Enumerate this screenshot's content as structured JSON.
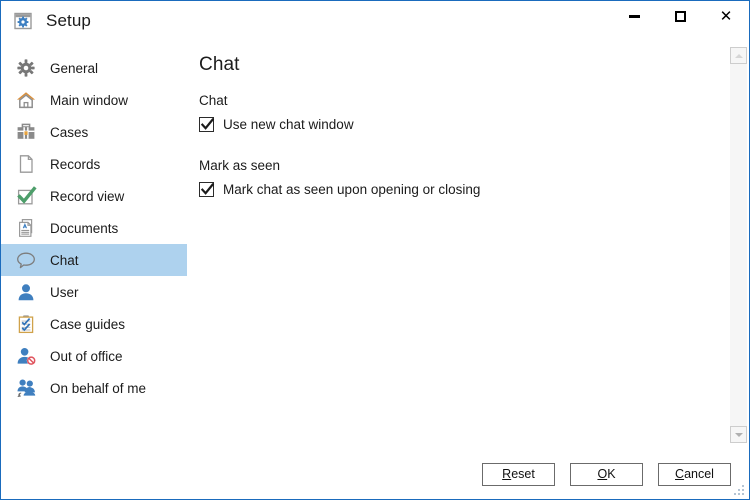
{
  "window": {
    "title": "Setup",
    "app_icon": "setup-gear-window-icon",
    "border_color": "#1a6bbd",
    "controls": {
      "minimize": "–",
      "maximize": "□",
      "close": "✕"
    }
  },
  "sidebar": {
    "selected": "Chat",
    "selected_color": "#aed2ee",
    "items": [
      {
        "label": "General",
        "icon": "gear-icon"
      },
      {
        "label": "Main window",
        "icon": "home-icon"
      },
      {
        "label": "Cases",
        "icon": "briefcase-icon"
      },
      {
        "label": "Records",
        "icon": "page-icon"
      },
      {
        "label": "Record view",
        "icon": "checkmark-box-icon"
      },
      {
        "label": "Documents",
        "icon": "document-text-icon"
      },
      {
        "label": "Chat",
        "icon": "speech-bubble-icon"
      },
      {
        "label": "User",
        "icon": "person-icon"
      },
      {
        "label": "Case guides",
        "icon": "clipboard-check-icon"
      },
      {
        "label": "Out of office",
        "icon": "person-blocked-icon"
      },
      {
        "label": "On behalf of me",
        "icon": "people-group-icon"
      }
    ]
  },
  "content": {
    "title": "Chat",
    "groups": [
      {
        "label": "Chat",
        "options": [
          {
            "label": "Use new chat window",
            "checked": true
          }
        ]
      },
      {
        "label": "Mark as seen",
        "options": [
          {
            "label": "Mark chat as seen upon opening or closing",
            "checked": true
          }
        ]
      }
    ]
  },
  "scrollbar": {
    "up_arrow": "scroll-up-arrow",
    "down_arrow": "scroll-down-arrow"
  },
  "footer": {
    "buttons": [
      {
        "id": "reset",
        "accel": "R",
        "before": "",
        "after": "eset"
      },
      {
        "id": "ok",
        "accel": "O",
        "before": "",
        "after": "K"
      },
      {
        "id": "cancel",
        "accel": "C",
        "before": "",
        "after": "ancel"
      }
    ]
  }
}
